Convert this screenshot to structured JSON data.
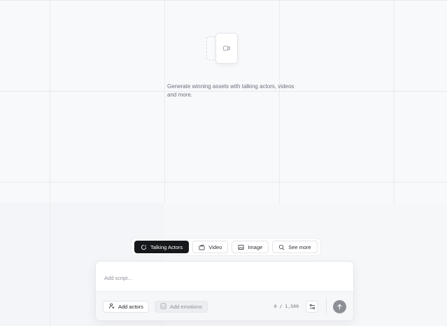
{
  "empty_state": {
    "text": "Generate winning assets with talking actors, videos and more.",
    "icon": "video-camera-icon"
  },
  "modes": [
    {
      "label": "Talking Actors",
      "icon": "sparkle-cycle-icon",
      "active": true
    },
    {
      "label": "Video",
      "icon": "clapper-icon",
      "active": false
    },
    {
      "label": "Image",
      "icon": "image-icon",
      "active": false
    },
    {
      "label": "See more",
      "icon": "search-icon",
      "active": false
    }
  ],
  "composer": {
    "script_placeholder": "Add script...",
    "script_value": "",
    "add_actors_label": "Add actors",
    "add_emotions_label": "Add emotions",
    "char_count": "0 / 1,500",
    "settings_icon": "sliders-icon",
    "send_icon": "arrow-up-icon"
  },
  "colors": {
    "active_chip": "#17181b",
    "send_button": "#8d9097",
    "background": "#f6f7f9"
  }
}
